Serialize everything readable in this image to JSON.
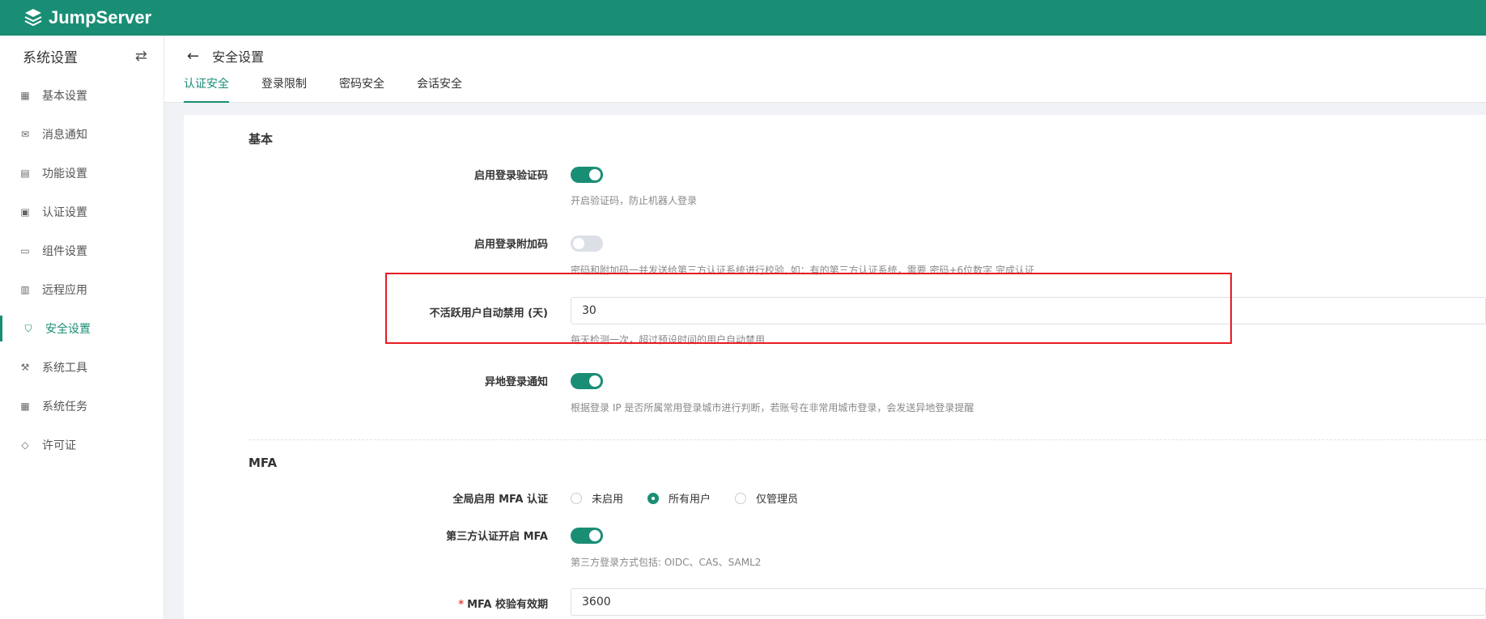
{
  "app": {
    "name": "JumpServer"
  },
  "sidebar": {
    "title": "系统设置",
    "items": [
      {
        "label": "基本设置",
        "icon": "grid-icon"
      },
      {
        "label": "消息通知",
        "icon": "message-icon"
      },
      {
        "label": "功能设置",
        "icon": "feature-icon"
      },
      {
        "label": "认证设置",
        "icon": "id-card-icon"
      },
      {
        "label": "组件设置",
        "icon": "monitor-icon"
      },
      {
        "label": "远程应用",
        "icon": "apps-icon"
      },
      {
        "label": "安全设置",
        "icon": "shield-icon",
        "active": true
      },
      {
        "label": "系统工具",
        "icon": "tools-icon"
      },
      {
        "label": "系统任务",
        "icon": "calendar-icon"
      },
      {
        "label": "许可证",
        "icon": "diamond-icon"
      }
    ]
  },
  "page": {
    "title": "安全设置",
    "tabs": [
      "认证安全",
      "登录限制",
      "密码安全",
      "会话安全"
    ]
  },
  "basic": {
    "section_title": "基本",
    "captcha": {
      "label": "启用登录验证码",
      "help": "开启验证码，防止机器人登录",
      "enabled": true
    },
    "extra_code": {
      "label": "启用登录附加码",
      "help": "密码和附加码一并发送给第三方认证系统进行校验, 如：有的第三方认证系统，需要 密码+6位数字 完成认证",
      "enabled": false
    },
    "inactive_disable": {
      "label": "不活跃用户自动禁用 (天)",
      "value": "30",
      "help": "每天检测一次，超过预设时间的用户自动禁用"
    },
    "remote_login_notice": {
      "label": "异地登录通知",
      "help": "根据登录 IP 是否所属常用登录城市进行判断，若账号在非常用城市登录，会发送异地登录提醒",
      "enabled": true
    }
  },
  "mfa": {
    "section_title": "MFA",
    "global": {
      "label": "全局启用 MFA 认证",
      "options": [
        "未启用",
        "所有用户",
        "仅管理员"
      ],
      "selected": "所有用户"
    },
    "third_party": {
      "label": "第三方认证开启 MFA",
      "help": "第三方登录方式包括: OIDC、CAS、SAML2",
      "enabled": true
    },
    "verify_ttl": {
      "required_mark": "*",
      "label": "MFA 校验有效期",
      "value": "3600"
    }
  },
  "colors": {
    "brand": "#1a8e75",
    "highlight": "#e51c23"
  }
}
